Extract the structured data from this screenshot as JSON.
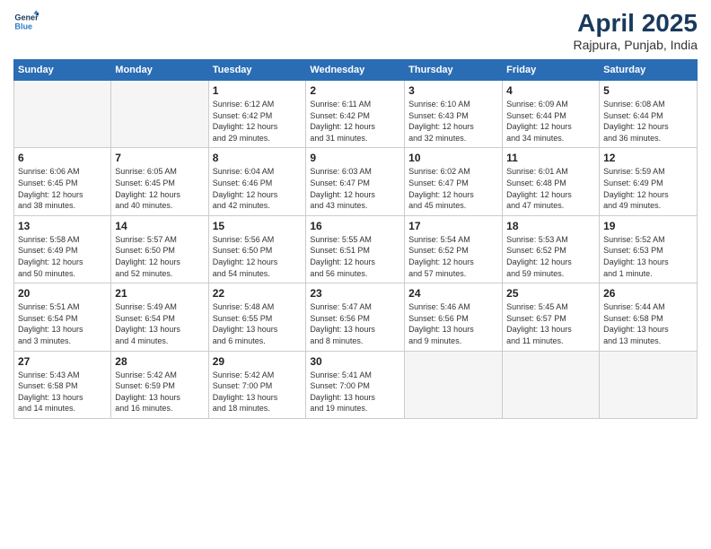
{
  "logo": {
    "line1": "General",
    "line2": "Blue"
  },
  "title": "April 2025",
  "location": "Rajpura, Punjab, India",
  "weekdays": [
    "Sunday",
    "Monday",
    "Tuesday",
    "Wednesday",
    "Thursday",
    "Friday",
    "Saturday"
  ],
  "weeks": [
    [
      {
        "day": "",
        "info": ""
      },
      {
        "day": "",
        "info": ""
      },
      {
        "day": "1",
        "info": "Sunrise: 6:12 AM\nSunset: 6:42 PM\nDaylight: 12 hours\nand 29 minutes."
      },
      {
        "day": "2",
        "info": "Sunrise: 6:11 AM\nSunset: 6:42 PM\nDaylight: 12 hours\nand 31 minutes."
      },
      {
        "day": "3",
        "info": "Sunrise: 6:10 AM\nSunset: 6:43 PM\nDaylight: 12 hours\nand 32 minutes."
      },
      {
        "day": "4",
        "info": "Sunrise: 6:09 AM\nSunset: 6:44 PM\nDaylight: 12 hours\nand 34 minutes."
      },
      {
        "day": "5",
        "info": "Sunrise: 6:08 AM\nSunset: 6:44 PM\nDaylight: 12 hours\nand 36 minutes."
      }
    ],
    [
      {
        "day": "6",
        "info": "Sunrise: 6:06 AM\nSunset: 6:45 PM\nDaylight: 12 hours\nand 38 minutes."
      },
      {
        "day": "7",
        "info": "Sunrise: 6:05 AM\nSunset: 6:45 PM\nDaylight: 12 hours\nand 40 minutes."
      },
      {
        "day": "8",
        "info": "Sunrise: 6:04 AM\nSunset: 6:46 PM\nDaylight: 12 hours\nand 42 minutes."
      },
      {
        "day": "9",
        "info": "Sunrise: 6:03 AM\nSunset: 6:47 PM\nDaylight: 12 hours\nand 43 minutes."
      },
      {
        "day": "10",
        "info": "Sunrise: 6:02 AM\nSunset: 6:47 PM\nDaylight: 12 hours\nand 45 minutes."
      },
      {
        "day": "11",
        "info": "Sunrise: 6:01 AM\nSunset: 6:48 PM\nDaylight: 12 hours\nand 47 minutes."
      },
      {
        "day": "12",
        "info": "Sunrise: 5:59 AM\nSunset: 6:49 PM\nDaylight: 12 hours\nand 49 minutes."
      }
    ],
    [
      {
        "day": "13",
        "info": "Sunrise: 5:58 AM\nSunset: 6:49 PM\nDaylight: 12 hours\nand 50 minutes."
      },
      {
        "day": "14",
        "info": "Sunrise: 5:57 AM\nSunset: 6:50 PM\nDaylight: 12 hours\nand 52 minutes."
      },
      {
        "day": "15",
        "info": "Sunrise: 5:56 AM\nSunset: 6:50 PM\nDaylight: 12 hours\nand 54 minutes."
      },
      {
        "day": "16",
        "info": "Sunrise: 5:55 AM\nSunset: 6:51 PM\nDaylight: 12 hours\nand 56 minutes."
      },
      {
        "day": "17",
        "info": "Sunrise: 5:54 AM\nSunset: 6:52 PM\nDaylight: 12 hours\nand 57 minutes."
      },
      {
        "day": "18",
        "info": "Sunrise: 5:53 AM\nSunset: 6:52 PM\nDaylight: 12 hours\nand 59 minutes."
      },
      {
        "day": "19",
        "info": "Sunrise: 5:52 AM\nSunset: 6:53 PM\nDaylight: 13 hours\nand 1 minute."
      }
    ],
    [
      {
        "day": "20",
        "info": "Sunrise: 5:51 AM\nSunset: 6:54 PM\nDaylight: 13 hours\nand 3 minutes."
      },
      {
        "day": "21",
        "info": "Sunrise: 5:49 AM\nSunset: 6:54 PM\nDaylight: 13 hours\nand 4 minutes."
      },
      {
        "day": "22",
        "info": "Sunrise: 5:48 AM\nSunset: 6:55 PM\nDaylight: 13 hours\nand 6 minutes."
      },
      {
        "day": "23",
        "info": "Sunrise: 5:47 AM\nSunset: 6:56 PM\nDaylight: 13 hours\nand 8 minutes."
      },
      {
        "day": "24",
        "info": "Sunrise: 5:46 AM\nSunset: 6:56 PM\nDaylight: 13 hours\nand 9 minutes."
      },
      {
        "day": "25",
        "info": "Sunrise: 5:45 AM\nSunset: 6:57 PM\nDaylight: 13 hours\nand 11 minutes."
      },
      {
        "day": "26",
        "info": "Sunrise: 5:44 AM\nSunset: 6:58 PM\nDaylight: 13 hours\nand 13 minutes."
      }
    ],
    [
      {
        "day": "27",
        "info": "Sunrise: 5:43 AM\nSunset: 6:58 PM\nDaylight: 13 hours\nand 14 minutes."
      },
      {
        "day": "28",
        "info": "Sunrise: 5:42 AM\nSunset: 6:59 PM\nDaylight: 13 hours\nand 16 minutes."
      },
      {
        "day": "29",
        "info": "Sunrise: 5:42 AM\nSunset: 7:00 PM\nDaylight: 13 hours\nand 18 minutes."
      },
      {
        "day": "30",
        "info": "Sunrise: 5:41 AM\nSunset: 7:00 PM\nDaylight: 13 hours\nand 19 minutes."
      },
      {
        "day": "",
        "info": ""
      },
      {
        "day": "",
        "info": ""
      },
      {
        "day": "",
        "info": ""
      }
    ]
  ]
}
